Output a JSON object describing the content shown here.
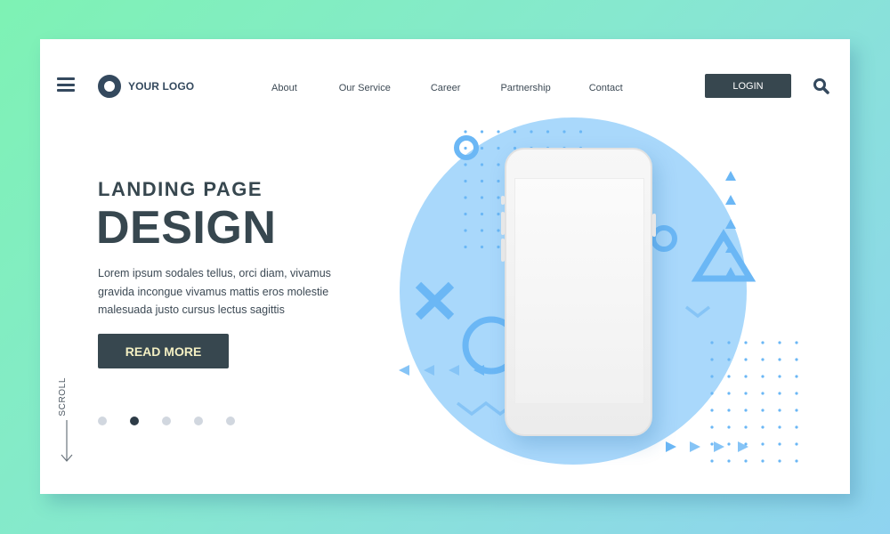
{
  "header": {
    "menu_icon": "hamburger-icon",
    "logo_text": "YOUR LOGO",
    "nav": [
      {
        "label": "About"
      },
      {
        "label": "Our Service"
      },
      {
        "label": "Career"
      },
      {
        "label": "Partnership"
      },
      {
        "label": "Contact"
      }
    ],
    "login_label": "LOGIN",
    "search_icon": "search-icon"
  },
  "hero": {
    "subtitle": "LANDING PAGE",
    "title": "DESIGN",
    "description": "Lorem ipsum sodales tellus, orci diam, vivamus gravida incongue vivamus mattis eros molestie malesuada justo cursus lectus sagittis",
    "cta_label": "READ MORE"
  },
  "scroll": {
    "label": "SCROLL"
  },
  "pagination": {
    "total": 5,
    "active_index": 1
  },
  "colors": {
    "primary_dark": "#37474f",
    "accent_blue": "#a9d8fb",
    "shape_blue": "#6bb7f5",
    "cta_text": "#f3efc2",
    "bg_gradient_start": "#7ef2b4",
    "bg_gradient_end": "#8fd3f0"
  }
}
